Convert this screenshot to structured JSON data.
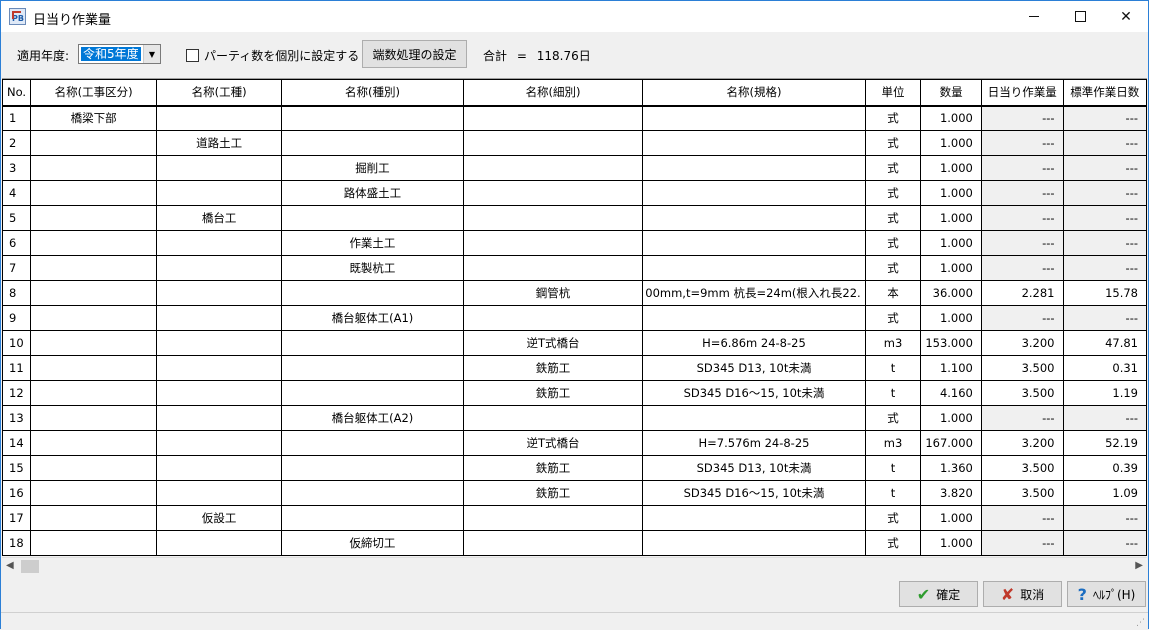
{
  "window": {
    "title": "日当り作業量"
  },
  "toolbar": {
    "year_label": "適用年度:",
    "year_value": "令和5年度",
    "checkbox_label": "パーティ数を個別に設定する",
    "rounding_button": "端数処理の設定",
    "total_label": "合計",
    "total_eq": "=",
    "total_value": "118.76日"
  },
  "table": {
    "headers": [
      "No.",
      "名称(工事区分)",
      "名称(工種)",
      "名称(種別)",
      "名称(細別)",
      "名称(規格)",
      "単位",
      "数量",
      "日当り作業量",
      "標準作業日数"
    ],
    "rows": [
      [
        "1",
        "橋梁下部",
        "",
        "",
        "",
        "",
        "式",
        "1.000",
        "---",
        "---"
      ],
      [
        "2",
        "",
        "道路土工",
        "",
        "",
        "",
        "式",
        "1.000",
        "---",
        "---"
      ],
      [
        "3",
        "",
        "",
        "掘削工",
        "",
        "",
        "式",
        "1.000",
        "---",
        "---"
      ],
      [
        "4",
        "",
        "",
        "路体盛土工",
        "",
        "",
        "式",
        "1.000",
        "---",
        "---"
      ],
      [
        "5",
        "",
        "橋台工",
        "",
        "",
        "",
        "式",
        "1.000",
        "---",
        "---"
      ],
      [
        "6",
        "",
        "",
        "作業土工",
        "",
        "",
        "式",
        "1.000",
        "---",
        "---"
      ],
      [
        "7",
        "",
        "",
        "既製杭工",
        "",
        "",
        "式",
        "1.000",
        "---",
        "---"
      ],
      [
        "8",
        "",
        "",
        "",
        "鋼管杭",
        "00mm,t=9mm 杭長=24m(根入れ長22.",
        "本",
        "36.000",
        "2.281",
        "15.78"
      ],
      [
        "9",
        "",
        "",
        "橋台躯体工(A1)",
        "",
        "",
        "式",
        "1.000",
        "---",
        "---"
      ],
      [
        "10",
        "",
        "",
        "",
        "逆T式橋台",
        "H=6.86m 24-8-25",
        "m3",
        "153.000",
        "3.200",
        "47.81"
      ],
      [
        "11",
        "",
        "",
        "",
        "鉄筋工",
        "SD345 D13, 10t未満",
        "t",
        "1.100",
        "3.500",
        "0.31"
      ],
      [
        "12",
        "",
        "",
        "",
        "鉄筋工",
        "SD345 D16～15, 10t未満",
        "t",
        "4.160",
        "3.500",
        "1.19"
      ],
      [
        "13",
        "",
        "",
        "橋台躯体工(A2)",
        "",
        "",
        "式",
        "1.000",
        "---",
        "---"
      ],
      [
        "14",
        "",
        "",
        "",
        "逆T式橋台",
        "H=7.576m 24-8-25",
        "m3",
        "167.000",
        "3.200",
        "52.19"
      ],
      [
        "15",
        "",
        "",
        "",
        "鉄筋工",
        "SD345 D13, 10t未満",
        "t",
        "1.360",
        "3.500",
        "0.39"
      ],
      [
        "16",
        "",
        "",
        "",
        "鉄筋工",
        "SD345 D16～15, 10t未満",
        "t",
        "3.820",
        "3.500",
        "1.09"
      ],
      [
        "17",
        "",
        "仮設工",
        "",
        "",
        "",
        "式",
        "1.000",
        "---",
        "---"
      ],
      [
        "18",
        "",
        "",
        "仮締切工",
        "",
        "",
        "式",
        "1.000",
        "---",
        "---"
      ]
    ]
  },
  "buttons": {
    "ok": "確定",
    "cancel": "取消",
    "help": "ﾍﾙﾌﾟ(H)"
  },
  "icons": {
    "ok": "checkmark-icon",
    "cancel": "x-icon",
    "help": "question-icon"
  }
}
